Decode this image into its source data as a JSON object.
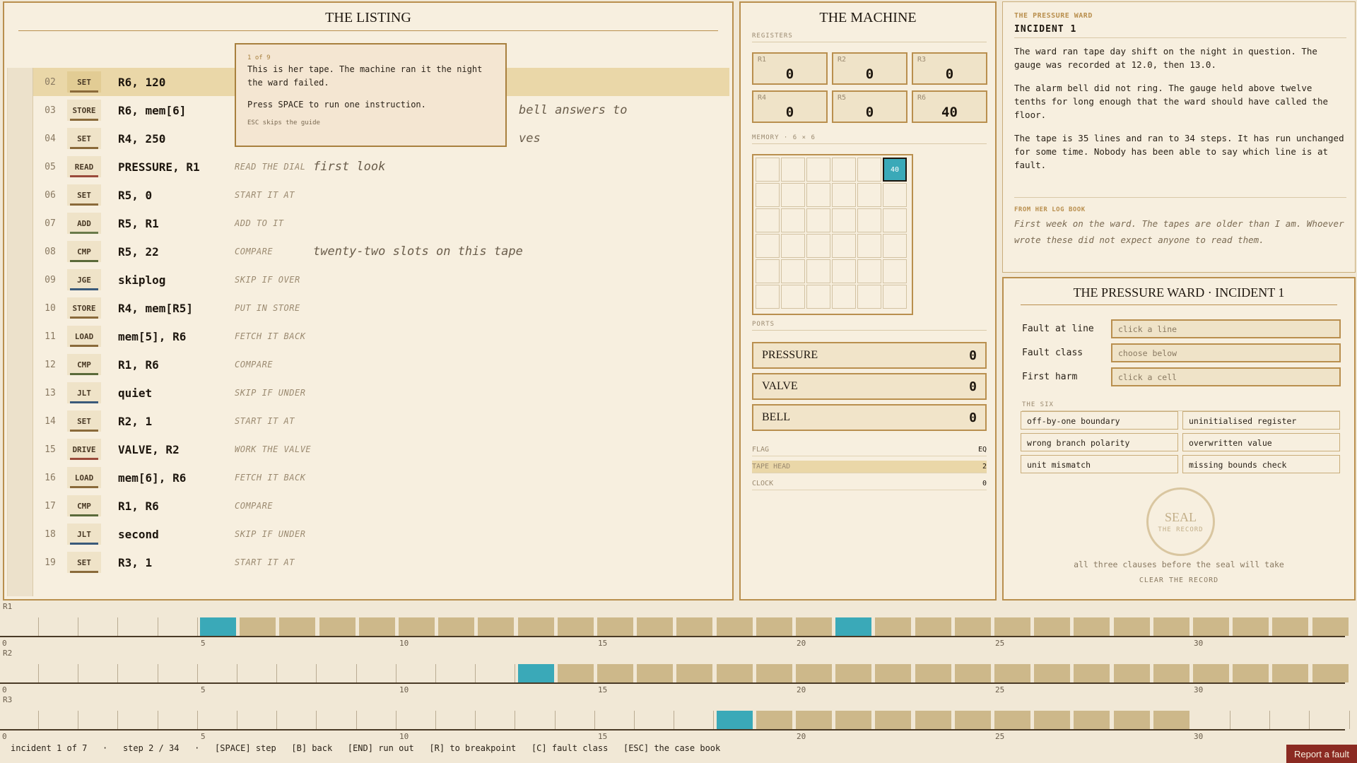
{
  "listing": {
    "title": "THE LISTING",
    "lines": [
      {
        "num": "02",
        "op": "SET",
        "args": "R6, 120",
        "gloss": "",
        "note": "",
        "color": "#8a6a3a"
      },
      {
        "num": "03",
        "op": "STORE",
        "args": "R6, mem[6]",
        "gloss": "",
        "note": "bell answers to",
        "color": "#8a6a3a"
      },
      {
        "num": "04",
        "op": "SET",
        "args": "R4, 250",
        "gloss": "",
        "note": "ves",
        "color": "#8a6a3a"
      },
      {
        "num": "05",
        "op": "READ",
        "args": "PRESSURE, R1",
        "gloss": "READ THE DIAL",
        "note": "first look",
        "color": "#9a4a3a"
      },
      {
        "num": "06",
        "op": "SET",
        "args": "R5, 0",
        "gloss": "START IT AT",
        "note": "",
        "color": "#8a6a3a"
      },
      {
        "num": "07",
        "op": "ADD",
        "args": "R5, R1",
        "gloss": "ADD TO IT",
        "note": "",
        "color": "#6a7a4a"
      },
      {
        "num": "08",
        "op": "CMP",
        "args": "R5, 22",
        "gloss": "COMPARE",
        "note": "twenty-two slots on this tape",
        "color": "#5a6a3a"
      },
      {
        "num": "09",
        "op": "JGE",
        "args": "skiplog",
        "gloss": "SKIP IF OVER",
        "note": "",
        "color": "#3a5a7a"
      },
      {
        "num": "10",
        "op": "STORE",
        "args": "R4, mem[R5]",
        "gloss": "PUT IN STORE",
        "note": "",
        "color": "#8a6a3a"
      },
      {
        "num": "11",
        "op": "LOAD",
        "args": "mem[5], R6",
        "gloss": "FETCH IT BACK",
        "note": "",
        "color": "#8a6a3a"
      },
      {
        "num": "12",
        "op": "CMP",
        "args": "R1, R6",
        "gloss": "COMPARE",
        "note": "",
        "color": "#5a6a3a"
      },
      {
        "num": "13",
        "op": "JLT",
        "args": "quiet",
        "gloss": "SKIP IF UNDER",
        "note": "",
        "color": "#3a5a7a"
      },
      {
        "num": "14",
        "op": "SET",
        "args": "R2, 1",
        "gloss": "START IT AT",
        "note": "",
        "color": "#8a6a3a"
      },
      {
        "num": "15",
        "op": "DRIVE",
        "args": "VALVE, R2",
        "gloss": "WORK THE VALVE",
        "note": "",
        "color": "#9a4a3a"
      },
      {
        "num": "16",
        "op": "LOAD",
        "args": "mem[6], R6",
        "gloss": "FETCH IT BACK",
        "note": "",
        "color": "#8a6a3a"
      },
      {
        "num": "17",
        "op": "CMP",
        "args": "R1, R6",
        "gloss": "COMPARE",
        "note": "",
        "color": "#5a6a3a"
      },
      {
        "num": "18",
        "op": "JLT",
        "args": "second",
        "gloss": "SKIP IF UNDER",
        "note": "",
        "color": "#3a5a7a"
      },
      {
        "num": "19",
        "op": "SET",
        "args": "R3, 1",
        "gloss": "START IT AT",
        "note": "",
        "color": "#8a6a3a"
      }
    ],
    "current_line": "02"
  },
  "guide": {
    "count": "1 of 9",
    "text": "This is her tape. The machine ran it the night the ward failed.",
    "text2": "Press SPACE to run one instruction.",
    "skip": "ESC skips the guide"
  },
  "machine": {
    "title": "THE MACHINE",
    "registers_label": "REGISTERS",
    "registers": [
      {
        "name": "R1",
        "value": "0"
      },
      {
        "name": "R2",
        "value": "0"
      },
      {
        "name": "R3",
        "value": "0"
      },
      {
        "name": "R4",
        "value": "0"
      },
      {
        "name": "R5",
        "value": "0"
      },
      {
        "name": "R6",
        "value": "40"
      }
    ],
    "memory_label": "MEMORY · 6 × 6",
    "memory": [
      "",
      "",
      "",
      "",
      "",
      "40",
      "",
      "",
      "",
      "",
      "",
      "",
      "",
      "",
      "",
      "",
      "",
      "",
      "",
      "",
      "",
      "",
      "",
      "",
      "",
      "",
      "",
      "",
      "",
      "",
      "",
      "",
      "",
      "",
      "",
      ""
    ],
    "ports_label": "PORTS",
    "ports": [
      {
        "name": "PRESSURE",
        "value": "0"
      },
      {
        "name": "VALVE",
        "value": "0"
      },
      {
        "name": "BELL",
        "value": "0"
      }
    ],
    "flag_label": "FLAG",
    "flag_value": "EQ",
    "tape_head_label": "TAPE HEAD",
    "tape_head_value": "2",
    "clock_label": "CLOCK",
    "clock_value": "0"
  },
  "casefile": {
    "ward": "THE PRESSURE WARD",
    "incident": "INCIDENT 1",
    "p1": "The ward ran tape day shift on the night in question. The gauge was recorded at 12.0, then 13.0.",
    "p2": "The alarm bell did not ring. The gauge held above twelve tenths for long enough that the ward should have called the floor.",
    "p3": "The tape is 35 lines and ran to 34 steps. It has run unchanged for some time. Nobody has been able to say which line is at fault.",
    "log_label": "FROM HER LOG BOOK",
    "log": "First week on the ward. The tapes are older than I am. Whoever wrote these did not expect anyone to read them."
  },
  "report": {
    "title": "THE PRESSURE WARD · INCIDENT 1",
    "fields": [
      {
        "label": "Fault at line",
        "placeholder": "click a line"
      },
      {
        "label": "Fault class",
        "placeholder": "choose below"
      },
      {
        "label": "First harm",
        "placeholder": "click a cell"
      }
    ],
    "six_label": "THE SIX",
    "six": [
      "off-by-one boundary",
      "uninitialised register",
      "wrong branch polarity",
      "overwritten value",
      "unit mismatch",
      "missing bounds check"
    ],
    "seal": "SEAL",
    "seal_sub": "THE RECORD",
    "seal_hint": "all three clauses before the seal will take",
    "clear": "CLEAR THE RECORD"
  },
  "timelines": [
    {
      "label": "R1",
      "set_from": 5,
      "marks": [
        5,
        21
      ],
      "empty_after": null
    },
    {
      "label": "R2",
      "set_from": 13,
      "marks": [
        13
      ],
      "empty_after": null
    },
    {
      "label": "R3",
      "set_from": 18,
      "marks": [
        18
      ],
      "empty_after": 30
    }
  ],
  "timeline_ticks": [
    "0",
    "5",
    "10",
    "15",
    "20",
    "25",
    "30"
  ],
  "status": {
    "incident": "incident 1 of 7",
    "step": "step 2 / 34",
    "keys": "[SPACE] step   [B] back   [END] run out   [R] to breakpoint   [C] fault class   [ESC] the case book"
  },
  "report_button": "Report a fault",
  "colors": {
    "accent": "#b98f4e",
    "teal": "#3aa9b8",
    "report": "#8b2a22"
  }
}
